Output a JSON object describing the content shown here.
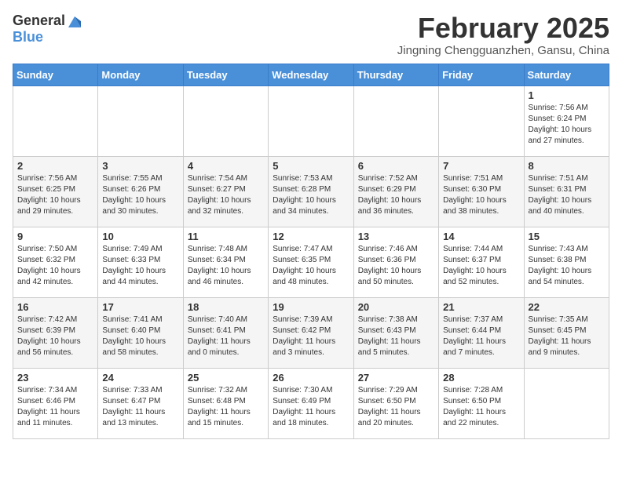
{
  "header": {
    "logo_general": "General",
    "logo_blue": "Blue",
    "month_title": "February 2025",
    "location": "Jingning Chengguanzhen, Gansu, China"
  },
  "weekdays": [
    "Sunday",
    "Monday",
    "Tuesday",
    "Wednesday",
    "Thursday",
    "Friday",
    "Saturday"
  ],
  "weeks": [
    [
      {
        "day": "",
        "info": ""
      },
      {
        "day": "",
        "info": ""
      },
      {
        "day": "",
        "info": ""
      },
      {
        "day": "",
        "info": ""
      },
      {
        "day": "",
        "info": ""
      },
      {
        "day": "",
        "info": ""
      },
      {
        "day": "1",
        "info": "Sunrise: 7:56 AM\nSunset: 6:24 PM\nDaylight: 10 hours and 27 minutes."
      }
    ],
    [
      {
        "day": "2",
        "info": "Sunrise: 7:56 AM\nSunset: 6:25 PM\nDaylight: 10 hours and 29 minutes."
      },
      {
        "day": "3",
        "info": "Sunrise: 7:55 AM\nSunset: 6:26 PM\nDaylight: 10 hours and 30 minutes."
      },
      {
        "day": "4",
        "info": "Sunrise: 7:54 AM\nSunset: 6:27 PM\nDaylight: 10 hours and 32 minutes."
      },
      {
        "day": "5",
        "info": "Sunrise: 7:53 AM\nSunset: 6:28 PM\nDaylight: 10 hours and 34 minutes."
      },
      {
        "day": "6",
        "info": "Sunrise: 7:52 AM\nSunset: 6:29 PM\nDaylight: 10 hours and 36 minutes."
      },
      {
        "day": "7",
        "info": "Sunrise: 7:51 AM\nSunset: 6:30 PM\nDaylight: 10 hours and 38 minutes."
      },
      {
        "day": "8",
        "info": "Sunrise: 7:51 AM\nSunset: 6:31 PM\nDaylight: 10 hours and 40 minutes."
      }
    ],
    [
      {
        "day": "9",
        "info": "Sunrise: 7:50 AM\nSunset: 6:32 PM\nDaylight: 10 hours and 42 minutes."
      },
      {
        "day": "10",
        "info": "Sunrise: 7:49 AM\nSunset: 6:33 PM\nDaylight: 10 hours and 44 minutes."
      },
      {
        "day": "11",
        "info": "Sunrise: 7:48 AM\nSunset: 6:34 PM\nDaylight: 10 hours and 46 minutes."
      },
      {
        "day": "12",
        "info": "Sunrise: 7:47 AM\nSunset: 6:35 PM\nDaylight: 10 hours and 48 minutes."
      },
      {
        "day": "13",
        "info": "Sunrise: 7:46 AM\nSunset: 6:36 PM\nDaylight: 10 hours and 50 minutes."
      },
      {
        "day": "14",
        "info": "Sunrise: 7:44 AM\nSunset: 6:37 PM\nDaylight: 10 hours and 52 minutes."
      },
      {
        "day": "15",
        "info": "Sunrise: 7:43 AM\nSunset: 6:38 PM\nDaylight: 10 hours and 54 minutes."
      }
    ],
    [
      {
        "day": "16",
        "info": "Sunrise: 7:42 AM\nSunset: 6:39 PM\nDaylight: 10 hours and 56 minutes."
      },
      {
        "day": "17",
        "info": "Sunrise: 7:41 AM\nSunset: 6:40 PM\nDaylight: 10 hours and 58 minutes."
      },
      {
        "day": "18",
        "info": "Sunrise: 7:40 AM\nSunset: 6:41 PM\nDaylight: 11 hours and 0 minutes."
      },
      {
        "day": "19",
        "info": "Sunrise: 7:39 AM\nSunset: 6:42 PM\nDaylight: 11 hours and 3 minutes."
      },
      {
        "day": "20",
        "info": "Sunrise: 7:38 AM\nSunset: 6:43 PM\nDaylight: 11 hours and 5 minutes."
      },
      {
        "day": "21",
        "info": "Sunrise: 7:37 AM\nSunset: 6:44 PM\nDaylight: 11 hours and 7 minutes."
      },
      {
        "day": "22",
        "info": "Sunrise: 7:35 AM\nSunset: 6:45 PM\nDaylight: 11 hours and 9 minutes."
      }
    ],
    [
      {
        "day": "23",
        "info": "Sunrise: 7:34 AM\nSunset: 6:46 PM\nDaylight: 11 hours and 11 minutes."
      },
      {
        "day": "24",
        "info": "Sunrise: 7:33 AM\nSunset: 6:47 PM\nDaylight: 11 hours and 13 minutes."
      },
      {
        "day": "25",
        "info": "Sunrise: 7:32 AM\nSunset: 6:48 PM\nDaylight: 11 hours and 15 minutes."
      },
      {
        "day": "26",
        "info": "Sunrise: 7:30 AM\nSunset: 6:49 PM\nDaylight: 11 hours and 18 minutes."
      },
      {
        "day": "27",
        "info": "Sunrise: 7:29 AM\nSunset: 6:50 PM\nDaylight: 11 hours and 20 minutes."
      },
      {
        "day": "28",
        "info": "Sunrise: 7:28 AM\nSunset: 6:50 PM\nDaylight: 11 hours and 22 minutes."
      },
      {
        "day": "",
        "info": ""
      }
    ]
  ]
}
